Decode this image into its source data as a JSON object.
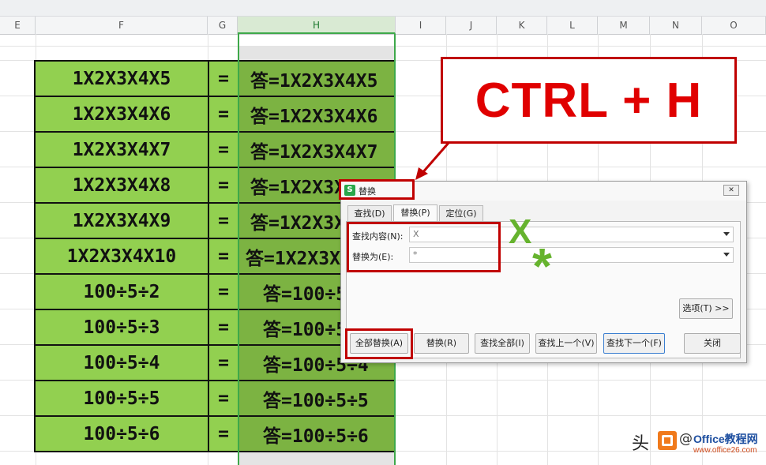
{
  "colors": {
    "accent_green": "#3ea84a",
    "cell_green": "#92d050",
    "answer_green": "#7cb342",
    "callout_red": "#e00000",
    "glyph_green": "#66b32e"
  },
  "columns": [
    "E",
    "F",
    "G",
    "H",
    "I",
    "J",
    "K",
    "L",
    "M",
    "N",
    "O"
  ],
  "table": {
    "rows": [
      {
        "expr": "1X2X3X4X5",
        "eq": "=",
        "answer": "答=1X2X3X4X5"
      },
      {
        "expr": "1X2X3X4X6",
        "eq": "=",
        "answer": "答=1X2X3X4X6"
      },
      {
        "expr": "1X2X3X4X7",
        "eq": "=",
        "answer": "答=1X2X3X4X7"
      },
      {
        "expr": "1X2X3X4X8",
        "eq": "=",
        "answer": "答=1X2X3X4X8"
      },
      {
        "expr": "1X2X3X4X9",
        "eq": "=",
        "answer": "答=1X2X3X4X9"
      },
      {
        "expr": "1X2X3X4X10",
        "eq": "=",
        "answer": "答=1X2X3X4X10"
      },
      {
        "expr": "100÷5÷2",
        "eq": "=",
        "answer": "答=100÷5÷2"
      },
      {
        "expr": "100÷5÷3",
        "eq": "=",
        "answer": "答=100÷5÷3"
      },
      {
        "expr": "100÷5÷4",
        "eq": "=",
        "answer": "答=100÷5÷4"
      },
      {
        "expr": "100÷5÷5",
        "eq": "=",
        "answer": "答=100÷5÷5"
      },
      {
        "expr": "100÷5÷6",
        "eq": "=",
        "answer": "答=100÷5÷6"
      }
    ]
  },
  "callout": {
    "text": "CTRL + H"
  },
  "dialog": {
    "icon": "S",
    "title": "替换",
    "close": "✕",
    "tabs": [
      "查找(D)",
      "替换(P)",
      "定位(G)"
    ],
    "find_label": "查找内容(N):",
    "find_value": "X",
    "replace_label": "替换为(E):",
    "replace_value": "*",
    "options_button": "选项(T) >>",
    "buttons": [
      "全部替换(A)",
      "替换(R)",
      "查找全部(I)",
      "查找上一个(V)",
      "查找下一个(F)",
      "关闭"
    ]
  },
  "annotations": {
    "x_glyph": "X",
    "star_glyph": "*"
  },
  "watermark": {
    "left_text": "头",
    "right_text": "@",
    "brand": "Office教程网",
    "url": "www.office26.com"
  }
}
